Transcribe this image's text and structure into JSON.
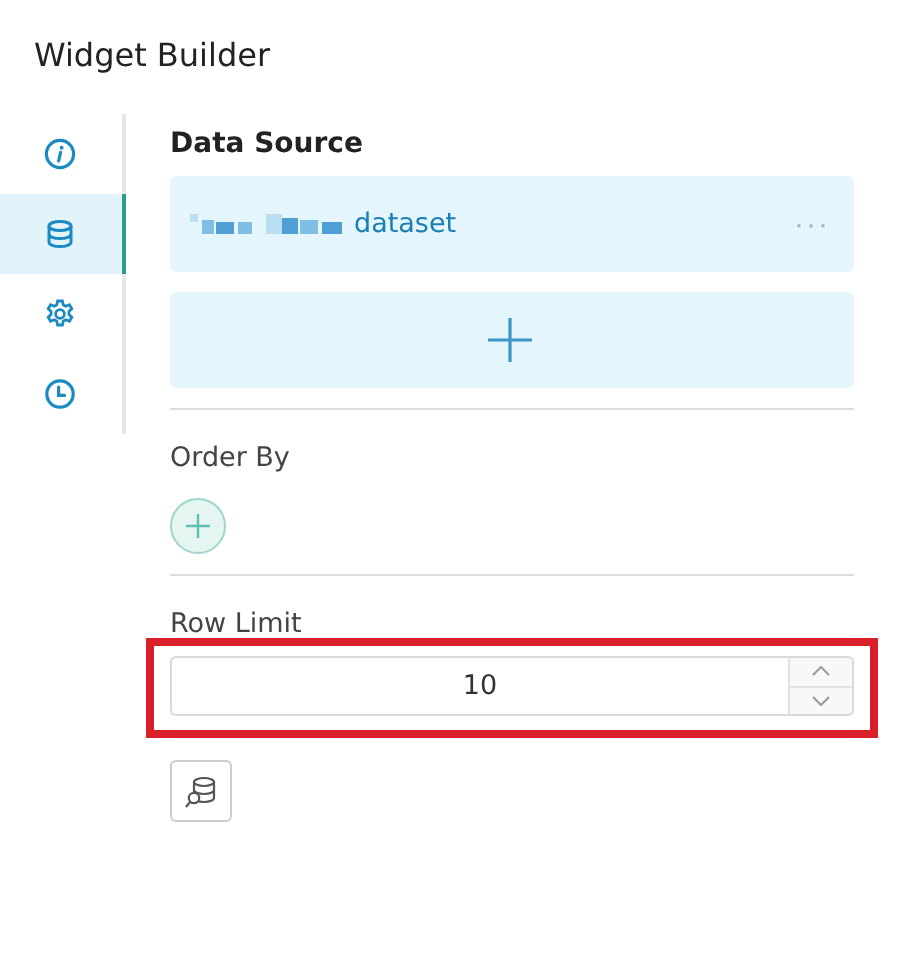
{
  "window": {
    "title": "Widget Builder"
  },
  "sidebar": {
    "items": [
      {
        "selected": false
      },
      {
        "selected": true
      },
      {
        "selected": false
      },
      {
        "selected": false
      }
    ]
  },
  "data_source": {
    "label": "Data Source",
    "dataset": "dataset",
    "menu": "···"
  },
  "order_by": {
    "label": "Order By"
  },
  "row_limit": {
    "label": "Row Limit",
    "value": "10",
    "highlighted": true
  }
}
